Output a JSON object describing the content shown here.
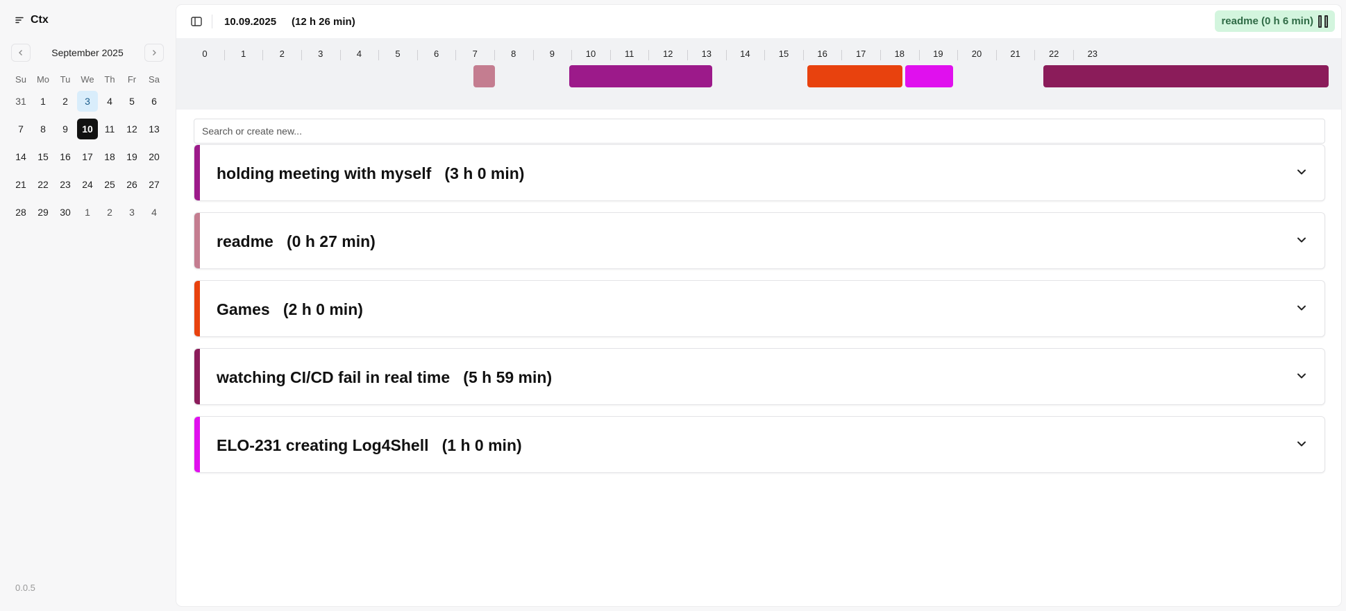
{
  "app": {
    "name": "Ctx",
    "version": "0.0.5"
  },
  "calendar": {
    "month_label": "September 2025",
    "weekdays": [
      "Su",
      "Mo",
      "Tu",
      "We",
      "Th",
      "Fr",
      "Sa"
    ],
    "weeks": [
      [
        "31",
        "1",
        "2",
        "3",
        "4",
        "5",
        "6"
      ],
      [
        "7",
        "8",
        "9",
        "10",
        "11",
        "12",
        "13"
      ],
      [
        "14",
        "15",
        "16",
        "17",
        "18",
        "19",
        "20"
      ],
      [
        "21",
        "22",
        "23",
        "24",
        "25",
        "26",
        "27"
      ],
      [
        "28",
        "29",
        "30",
        "1",
        "2",
        "3",
        "4"
      ]
    ],
    "today": "3",
    "selected": "10"
  },
  "header": {
    "date": "10.09.2025",
    "total": "(12 h 26 min)",
    "running_label": "readme (0 h 6 min)"
  },
  "timeline": {
    "hours": [
      "0",
      "1",
      "2",
      "3",
      "4",
      "5",
      "6",
      "7",
      "8",
      "9",
      "10",
      "11",
      "12",
      "13",
      "14",
      "15",
      "16",
      "17",
      "18",
      "19",
      "20",
      "21",
      "22",
      "23"
    ],
    "blocks": [
      {
        "task": "readme",
        "start": 6.05,
        "end": 6.5,
        "color": "#c47d90"
      },
      {
        "task": "holding meeting with myself",
        "start": 8.05,
        "end": 11.05,
        "color": "#9c1a8a"
      },
      {
        "task": "Games",
        "start": 13.05,
        "end": 15.05,
        "color": "#e8420e"
      },
      {
        "task": "ELO-231 creating Log4Shell",
        "start": 15.1,
        "end": 16.1,
        "color": "#e010ee"
      },
      {
        "task": "watching CI/CD fail in real time",
        "start": 18.0,
        "end": 23.99,
        "color": "#8b1c5a"
      }
    ]
  },
  "search": {
    "placeholder": "Search or create new..."
  },
  "tasks": [
    {
      "name": "holding meeting with myself",
      "duration": "(3 h 0 min)",
      "color": "#9c1a8a"
    },
    {
      "name": "readme",
      "duration": "(0 h 27 min)",
      "color": "#c47d90"
    },
    {
      "name": "Games",
      "duration": "(2 h 0 min)",
      "color": "#e8420e"
    },
    {
      "name": "watching CI/CD fail in real time",
      "duration": "(5 h 59 min)",
      "color": "#8b1c5a"
    },
    {
      "name": "ELO-231 creating Log4Shell",
      "duration": "(1 h 0 min)",
      "color": "#e010ee"
    }
  ]
}
